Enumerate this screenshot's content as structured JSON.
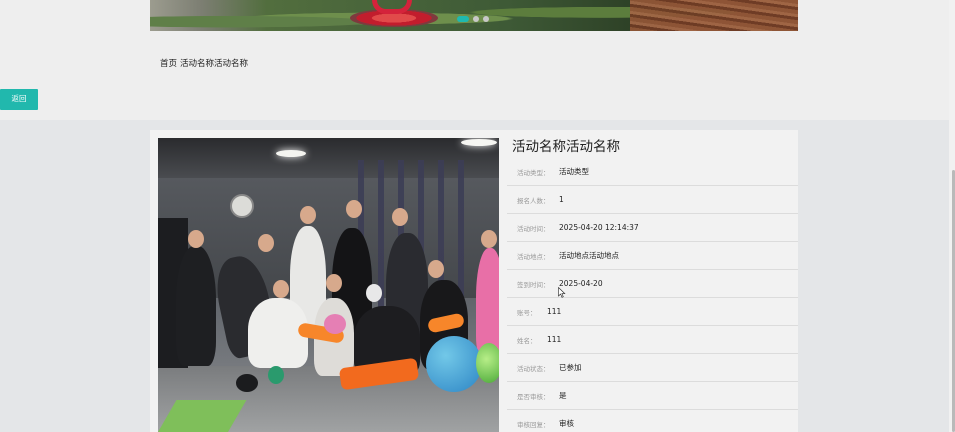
{
  "banner": {
    "dots": [
      true,
      false,
      false
    ],
    "accent_color": "#1fb9b0"
  },
  "breadcrumb": {
    "home": "首页",
    "current": "活动名称活动名称"
  },
  "back_button": {
    "label": "返回",
    "color": "#21b8ad"
  },
  "detail": {
    "title": "活动名称活动名称",
    "fields": [
      {
        "label": "活动类型：",
        "value": "活动类型"
      },
      {
        "label": "报名人数：",
        "value": "1"
      },
      {
        "label": "活动时间：",
        "value": "2025-04-20 12:14:37"
      },
      {
        "label": "活动地点：",
        "value": "活动地点活动地点"
      },
      {
        "label": "签到时间：",
        "value": "2025-04-20"
      },
      {
        "label": "账号：",
        "value": "111"
      },
      {
        "label": "姓名：",
        "value": "111"
      },
      {
        "label": "活动状态：",
        "value": "已参加"
      },
      {
        "label": "是否审核：",
        "value": "是"
      },
      {
        "label": "审核回复：",
        "value": "审核"
      }
    ]
  },
  "icons": {
    "cursor": "mouse-pointer-icon"
  }
}
